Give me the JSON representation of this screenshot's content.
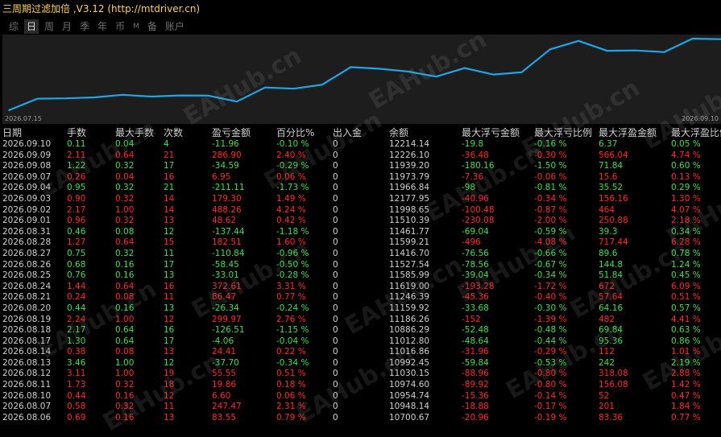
{
  "window": {
    "title": "三周期过滤加倍 ,V3.12 (http://mtdriver.cn)"
  },
  "tabs": [
    {
      "label": "综",
      "active": false
    },
    {
      "label": "日",
      "active": true
    },
    {
      "label": "周",
      "active": false
    },
    {
      "label": "月",
      "active": false
    },
    {
      "label": "季",
      "active": false
    },
    {
      "label": "年",
      "active": false
    },
    {
      "label": "币",
      "active": false
    },
    {
      "label": "M",
      "active": false
    },
    {
      "label": "备",
      "active": false
    },
    {
      "label": "账户",
      "active": false
    }
  ],
  "colors": {
    "line": "#1fa6e8",
    "positive": "#3ee04a",
    "negative": "#ff2626",
    "title": "#ffd34e"
  },
  "watermark": "EAHub.cn",
  "chart_data": {
    "type": "line",
    "x_start_label": "2026.07.15",
    "x_end_label": "2026.09.10",
    "x": [
      "2026.08.06",
      "2026.08.07",
      "2026.08.10",
      "2026.08.11",
      "2026.08.12",
      "2026.08.13",
      "2026.08.14",
      "2026.08.17",
      "2026.08.18",
      "2026.08.19",
      "2026.08.20",
      "2026.08.21",
      "2026.08.24",
      "2026.08.25",
      "2026.08.26",
      "2026.08.27",
      "2026.08.28",
      "2026.08.31",
      "2026.09.01",
      "2026.09.02",
      "2026.09.03",
      "2026.09.04",
      "2026.09.07",
      "2026.09.08",
      "2026.09.09",
      "2026.09.10"
    ],
    "values": [
      10700.67,
      10948.14,
      10954.74,
      10974.6,
      11030.15,
      10992.45,
      11016.86,
      11012.8,
      10886.29,
      11186.26,
      11159.92,
      11246.39,
      11619.0,
      11585.99,
      11527.54,
      11416.7,
      11599.21,
      11461.77,
      11510.39,
      11998.65,
      12177.95,
      11966.84,
      11973.79,
      11939.2,
      12226.1,
      12214.14
    ],
    "ylim": [
      10650,
      12260
    ],
    "grid": false
  },
  "table": {
    "headers": [
      "日期",
      "手数",
      "最大手数",
      "次数",
      "盈亏金额",
      "百分比%",
      "出入金",
      "余额",
      "最大浮亏金额",
      "最大浮亏比例",
      "最大浮盈金额",
      "最大浮盈比例"
    ],
    "rows": [
      {
        "sign": "pos",
        "cells": [
          "2026.09.10",
          "0.11",
          "0.04",
          "4",
          "-11.96",
          "-0.10 %",
          "0",
          "12214.14",
          "-19.8",
          "-0.16 %",
          "6.37",
          "0.05 %"
        ]
      },
      {
        "sign": "neg",
        "cells": [
          "2026.09.09",
          "2.11",
          "0.64",
          "21",
          "286.90",
          "2.40 %",
          "0",
          "12226.10",
          "-36.48",
          "-0.30 %",
          "566.04",
          "4.74 %"
        ]
      },
      {
        "sign": "pos",
        "cells": [
          "2026.09.08",
          "1.22",
          "0.32",
          "17",
          "-34.59",
          "-0.29 %",
          "0",
          "11939.20",
          "-180.16",
          "-1.50 %",
          "71.84",
          "0.60 %"
        ]
      },
      {
        "sign": "neg",
        "cells": [
          "2026.09.07",
          "0.26",
          "0.04",
          "16",
          "6.95",
          "0.06 %",
          "0",
          "11973.79",
          "-7.36",
          "-0.06 %",
          "15.6",
          "0.13 %"
        ]
      },
      {
        "sign": "pos",
        "cells": [
          "2026.09.04",
          "0.95",
          "0.32",
          "21",
          "-211.11",
          "-1.73 %",
          "0",
          "11966.84",
          "-98",
          "-0.81 %",
          "35.52",
          "0.29 %"
        ]
      },
      {
        "sign": "neg",
        "cells": [
          "2026.09.03",
          "0.90",
          "0.32",
          "14",
          "179.30",
          "1.49 %",
          "0",
          "12177.95",
          "-40.96",
          "-0.34 %",
          "156.16",
          "1.30 %"
        ]
      },
      {
        "sign": "neg",
        "cells": [
          "2026.09.02",
          "2.17",
          "1.00",
          "14",
          "488.26",
          "4.24 %",
          "0",
          "11998.65",
          "-100.48",
          "-0.87 %",
          "464",
          "4.07 %"
        ]
      },
      {
        "sign": "neg",
        "cells": [
          "2026.09.01",
          "0.96",
          "0.32",
          "13",
          "48.62",
          "0.42 %",
          "0",
          "11510.39",
          "-230.08",
          "-2.00 %",
          "250.88",
          "2.18 %"
        ]
      },
      {
        "sign": "pos",
        "cells": [
          "2026.08.31",
          "0.46",
          "0.08",
          "12",
          "-137.44",
          "-1.18 %",
          "0",
          "11461.77",
          "-69.04",
          "-0.59 %",
          "39.3",
          "0.34 %"
        ]
      },
      {
        "sign": "neg",
        "cells": [
          "2026.08.28",
          "1.27",
          "0.64",
          "15",
          "182.51",
          "1.60 %",
          "0",
          "11599.21",
          "-496",
          "-4.08 %",
          "717.44",
          "6.28 %"
        ]
      },
      {
        "sign": "pos",
        "cells": [
          "2026.08.27",
          "0.75",
          "0.32",
          "11",
          "-110.84",
          "-0.96 %",
          "0",
          "11416.70",
          "-76.56",
          "-0.66 %",
          "89.6",
          "0.78 %"
        ]
      },
      {
        "sign": "pos",
        "cells": [
          "2026.08.26",
          "0.68",
          "0.16",
          "17",
          "-58.45",
          "-0.50 %",
          "0",
          "11527.54",
          "-78.56",
          "-0.67 %",
          "144.8",
          "1.24 %"
        ]
      },
      {
        "sign": "pos",
        "cells": [
          "2026.08.25",
          "0.76",
          "0.16",
          "13",
          "-33.01",
          "-0.28 %",
          "0",
          "11585.99",
          "-39.04",
          "-0.34 %",
          "51.84",
          "0.45 %"
        ]
      },
      {
        "sign": "neg",
        "cells": [
          "2026.08.24",
          "1.44",
          "0.64",
          "16",
          "372.61",
          "3.31 %",
          "0",
          "11619.00",
          "-193.28",
          "-1.72 %",
          "672",
          "6.09 %"
        ]
      },
      {
        "sign": "neg",
        "cells": [
          "2026.08.21",
          "0.24",
          "0.08",
          "11",
          "86.47",
          "0.77 %",
          "0",
          "11246.39",
          "-45.36",
          "-0.40 %",
          "57.64",
          "0.51 %"
        ]
      },
      {
        "sign": "pos",
        "cells": [
          "2026.08.20",
          "0.44",
          "0.16",
          "13",
          "-26.34",
          "-0.24 %",
          "0",
          "11159.92",
          "-33.68",
          "-0.30 %",
          "64.16",
          "0.57 %"
        ]
      },
      {
        "sign": "neg",
        "cells": [
          "2026.08.19",
          "2.24",
          "1.00",
          "12",
          "299.97",
          "2.76 %",
          "0",
          "11186.26",
          "-152",
          "-1.39 %",
          "482",
          "4.41 %"
        ]
      },
      {
        "sign": "pos",
        "cells": [
          "2026.08.18",
          "2.17",
          "0.64",
          "16",
          "-126.51",
          "-1.15 %",
          "0",
          "10886.29",
          "-52.48",
          "-0.48 %",
          "69.84",
          "0.63 %"
        ]
      },
      {
        "sign": "pos",
        "cells": [
          "2026.08.17",
          "1.30",
          "0.64",
          "17",
          "-4.06",
          "-0.04 %",
          "0",
          "11012.80",
          "-48.64",
          "-0.44 %",
          "95.36",
          "0.86 %"
        ]
      },
      {
        "sign": "neg",
        "cells": [
          "2026.08.14",
          "0.38",
          "0.08",
          "13",
          "24.41",
          "0.22 %",
          "0",
          "11016.86",
          "-31.96",
          "-0.29 %",
          "112",
          "1.01 %"
        ]
      },
      {
        "sign": "pos",
        "cells": [
          "2026.08.13",
          "3.46",
          "1.00",
          "12",
          "-37.70",
          "-0.34 %",
          "0",
          "10992.45",
          "-59.84",
          "-0.53 %",
          "242",
          "2.19 %"
        ]
      },
      {
        "sign": "neg",
        "cells": [
          "2026.08.12",
          "3.11",
          "1.00",
          "19",
          "55.55",
          "0.51 %",
          "0",
          "11030.15",
          "-88.96",
          "-0.80 %",
          "318.08",
          "2.88 %"
        ]
      },
      {
        "sign": "neg",
        "cells": [
          "2026.08.11",
          "1.73",
          "0.32",
          "18",
          "19.86",
          "0.18 %",
          "0",
          "10974.60",
          "-89.92",
          "-0.80 %",
          "156.08",
          "1.42 %"
        ]
      },
      {
        "sign": "neg",
        "cells": [
          "2026.08.10",
          "0.44",
          "0.16",
          "12",
          "6.60",
          "0.06 %",
          "0",
          "10954.74",
          "-15.36",
          "-0.14 %",
          "52",
          "0.47 %"
        ]
      },
      {
        "sign": "neg",
        "cells": [
          "2026.08.07",
          "0.58",
          "0.32",
          "11",
          "247.47",
          "2.31 %",
          "0",
          "10948.14",
          "-18.88",
          "-0.17 %",
          "201",
          "1.84 %"
        ]
      },
      {
        "sign": "neg",
        "cells": [
          "2026.08.06",
          "0.69",
          "0.16",
          "13",
          "83.55",
          "0.79 %",
          "0",
          "10700.67",
          "-20.96",
          "-0.19 %",
          "83.36",
          "0.77 %"
        ]
      }
    ]
  }
}
